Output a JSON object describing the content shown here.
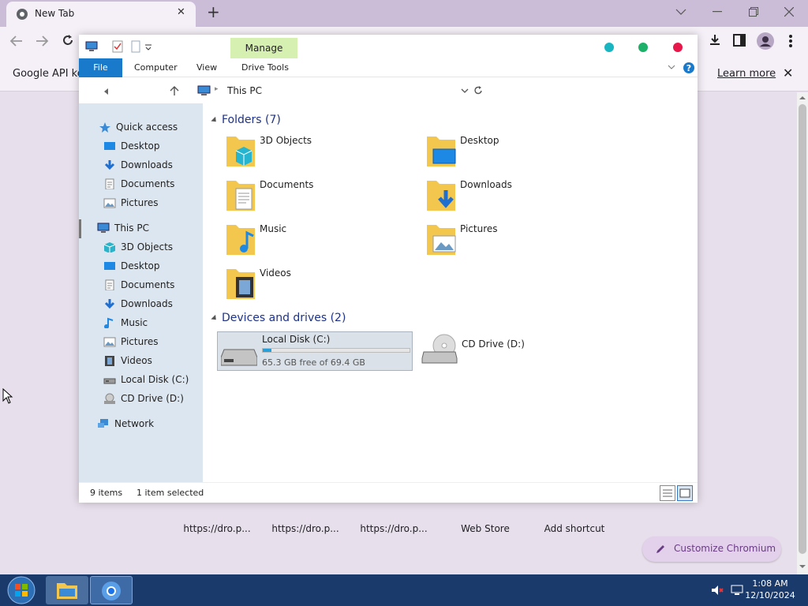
{
  "browser": {
    "tab_title": "New Tab",
    "new_tab_symbol": "+",
    "infobar_text": "Google API keys are missing. Some functionality of Chromium will be disabled.",
    "learn_more": "Learn more",
    "close_symbol": "✕",
    "shortcuts": [
      "https://dro.p...",
      "https://dro.p...",
      "https://dro.p...",
      "Web Store",
      "Add shortcut"
    ],
    "customize_label": "Customize Chromium"
  },
  "explorer": {
    "title": "This PC",
    "manage_label": "Manage",
    "ribbon_tabs": [
      "File",
      "Computer",
      "View",
      "Drive Tools"
    ],
    "address": "This PC",
    "nav": {
      "quick_access": "Quick access",
      "quick_items": [
        "Desktop",
        "Downloads",
        "Documents",
        "Pictures"
      ],
      "this_pc": "This PC",
      "pc_items": [
        "3D Objects",
        "Desktop",
        "Documents",
        "Downloads",
        "Music",
        "Pictures",
        "Videos",
        "Local Disk (C:)",
        "CD Drive (D:)"
      ],
      "network": "Network"
    },
    "folders_header": "Folders (7)",
    "folders": [
      "3D Objects",
      "Desktop",
      "Documents",
      "Downloads",
      "Music",
      "Pictures",
      "Videos"
    ],
    "drives_header": "Devices and drives (2)",
    "drives": [
      {
        "name": "Local Disk (C:)",
        "free_text": "65.3 GB free of 69.4 GB",
        "used_fraction": 0.06,
        "selected": true
      },
      {
        "name": "CD Drive (D:)"
      }
    ],
    "status_items": "9 items",
    "status_selected": "1 item selected"
  },
  "taskbar": {
    "time": "1:08 AM",
    "date": "12/10/2024"
  },
  "colors": {
    "accent": "#1979ca",
    "manage_bg": "#d5f0b0",
    "chrome_frame": "#cbbcd8",
    "taskbar": "#1a3a6c"
  }
}
